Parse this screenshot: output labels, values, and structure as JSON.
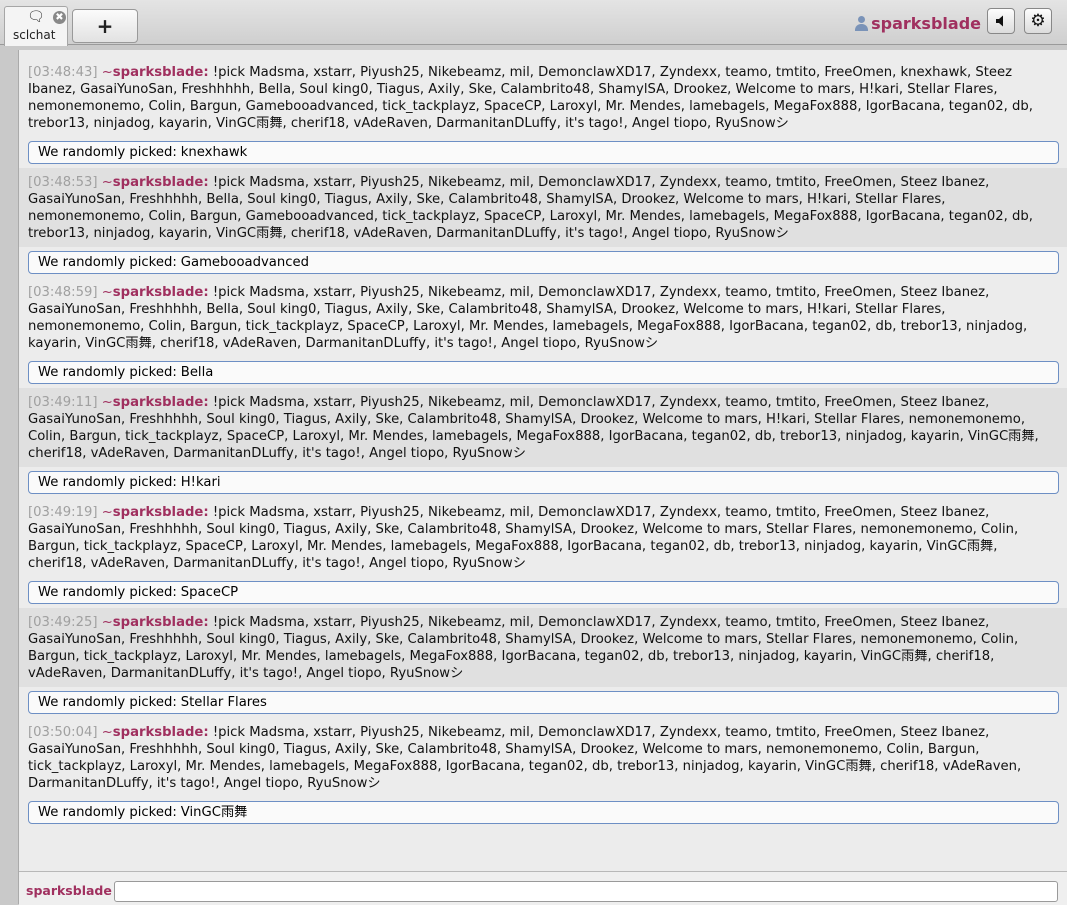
{
  "tabs": {
    "room_label": "sclchat",
    "chat_icon": "speech-bubble-icon",
    "close_icon": "✖",
    "new_tab_label": "+"
  },
  "header": {
    "username": "sparksblade",
    "user_icon": "user-icon",
    "sound_icon": "speaker-icon",
    "settings_icon": "gear-icon"
  },
  "colors": {
    "username": "#a0305f",
    "notice_border": "#6d8fc4"
  },
  "log": [
    {
      "timestamp": "[03:48:43]",
      "rank": "~",
      "author": "sparksblade:",
      "text": "!pick Madsma, xstarr, Piyush25, Nikebeamz, mil, DemonclawXD17, Zyndexx, teamo, tmtito, FreeOmen, knexhawk, Steez Ibanez, GasaiYunoSan, Freshhhhh, Bella, Soul king0, Tiagus, Axily, Ske, Calambrito48, ShamylSA, Drookez, Welcome to mars, H!kari, Stellar Flares, nemonemonemo, Colin, Bargun, Gamebooadvanced, tick_tackplayz, SpaceCP, Laroxyl, Mr. Mendes, lamebagels, MegaFox888, IgorBacana, tegan02, db, trebor13, ninjadog, kayarin, VinGC雨舞, cherif18, vAdeRaven, DarmanitanDLuffy, it's tago!, Angel tiopo, RyuSnowシ",
      "notice": "We randomly picked:",
      "picked": "knexhawk"
    },
    {
      "timestamp": "[03:48:53]",
      "rank": "~",
      "author": "sparksblade:",
      "text": "!pick Madsma, xstarr, Piyush25, Nikebeamz, mil, DemonclawXD17, Zyndexx, teamo, tmtito, FreeOmen, Steez Ibanez, GasaiYunoSan, Freshhhhh, Bella, Soul king0, Tiagus, Axily, Ske, Calambrito48, ShamylSA, Drookez, Welcome to mars, H!kari, Stellar Flares, nemonemonemo, Colin, Bargun, Gamebooadvanced, tick_tackplayz, SpaceCP, Laroxyl, Mr. Mendes, lamebagels, MegaFox888, IgorBacana, tegan02, db, trebor13, ninjadog, kayarin, VinGC雨舞, cherif18, vAdeRaven, DarmanitanDLuffy, it's tago!, Angel tiopo, RyuSnowシ",
      "notice": "We randomly picked:",
      "picked": "Gamebooadvanced"
    },
    {
      "timestamp": "[03:48:59]",
      "rank": "~",
      "author": "sparksblade:",
      "text": "!pick Madsma, xstarr, Piyush25, Nikebeamz, mil, DemonclawXD17, Zyndexx, teamo, tmtito, FreeOmen, Steez Ibanez, GasaiYunoSan, Freshhhhh, Bella, Soul king0, Tiagus, Axily, Ske, Calambrito48, ShamylSA, Drookez, Welcome to mars, H!kari, Stellar Flares, nemonemonemo, Colin, Bargun, tick_tackplayz, SpaceCP, Laroxyl, Mr. Mendes, lamebagels, MegaFox888, IgorBacana, tegan02, db, trebor13, ninjadog, kayarin, VinGC雨舞, cherif18, vAdeRaven, DarmanitanDLuffy, it's tago!, Angel tiopo, RyuSnowシ",
      "notice": "We randomly picked:",
      "picked": "Bella"
    },
    {
      "timestamp": "[03:49:11]",
      "rank": "~",
      "author": "sparksblade:",
      "text": "!pick Madsma, xstarr, Piyush25, Nikebeamz, mil, DemonclawXD17, Zyndexx, teamo, tmtito, FreeOmen, Steez Ibanez, GasaiYunoSan, Freshhhhh, Soul king0, Tiagus, Axily, Ske, Calambrito48, ShamylSA, Drookez, Welcome to mars, H!kari, Stellar Flares, nemonemonemo, Colin, Bargun, tick_tackplayz, SpaceCP, Laroxyl, Mr. Mendes, lamebagels, MegaFox888, IgorBacana, tegan02, db, trebor13, ninjadog, kayarin, VinGC雨舞, cherif18, vAdeRaven, DarmanitanDLuffy, it's tago!, Angel tiopo, RyuSnowシ",
      "notice": "We randomly picked:",
      "picked": "H!kari"
    },
    {
      "timestamp": "[03:49:19]",
      "rank": "~",
      "author": "sparksblade:",
      "text": "!pick Madsma, xstarr, Piyush25, Nikebeamz, mil, DemonclawXD17, Zyndexx, teamo, tmtito, FreeOmen, Steez Ibanez, GasaiYunoSan, Freshhhhh, Soul king0, Tiagus, Axily, Ske, Calambrito48, ShamylSA, Drookez, Welcome to mars, Stellar Flares, nemonemonemo, Colin, Bargun, tick_tackplayz, SpaceCP, Laroxyl, Mr. Mendes, lamebagels, MegaFox888, IgorBacana, tegan02, db, trebor13, ninjadog, kayarin, VinGC雨舞, cherif18, vAdeRaven, DarmanitanDLuffy, it's tago!, Angel tiopo, RyuSnowシ",
      "notice": "We randomly picked:",
      "picked": "SpaceCP"
    },
    {
      "timestamp": "[03:49:25]",
      "rank": "~",
      "author": "sparksblade:",
      "text": "!pick Madsma, xstarr, Piyush25, Nikebeamz, mil, DemonclawXD17, Zyndexx, teamo, tmtito, FreeOmen, Steez Ibanez, GasaiYunoSan, Freshhhhh, Soul king0, Tiagus, Axily, Ske, Calambrito48, ShamylSA, Drookez, Welcome to mars, Stellar Flares, nemonemonemo, Colin, Bargun, tick_tackplayz, Laroxyl, Mr. Mendes, lamebagels, MegaFox888, IgorBacana, tegan02, db, trebor13, ninjadog, kayarin, VinGC雨舞, cherif18, vAdeRaven, DarmanitanDLuffy, it's tago!, Angel tiopo, RyuSnowシ",
      "notice": "We randomly picked:",
      "picked": "Stellar Flares"
    },
    {
      "timestamp": "[03:50:04]",
      "rank": "~",
      "author": "sparksblade:",
      "text": "!pick Madsma, xstarr, Piyush25, Nikebeamz, mil, DemonclawXD17, Zyndexx, teamo, tmtito, FreeOmen, Steez Ibanez, GasaiYunoSan, Freshhhhh, Soul king0, Tiagus, Axily, Ske, Calambrito48, ShamylSA, Drookez, Welcome to mars, nemonemonemo, Colin, Bargun, tick_tackplayz, Laroxyl, Mr. Mendes, lamebagels, MegaFox888, IgorBacana, tegan02, db, trebor13, ninjadog, kayarin, VinGC雨舞, cherif18, vAdeRaven, DarmanitanDLuffy, it's tago!, Angel tiopo, RyuSnowシ",
      "notice": "We randomly picked:",
      "picked": "VinGC雨舞"
    }
  ],
  "composer": {
    "username": "sparksblade",
    "value": ""
  }
}
